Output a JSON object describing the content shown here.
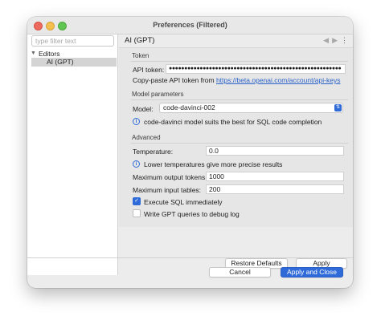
{
  "window": {
    "title": "Preferences (Filtered)"
  },
  "sidebar": {
    "filter_placeholder": "type filter text",
    "tree": {
      "editors_label": "Editors",
      "child_label": "AI (GPT)"
    }
  },
  "page": {
    "title": "AI (GPT)",
    "menu_icon": "⋮",
    "back_icon": "◀",
    "forward_icon": "▶"
  },
  "token": {
    "group_label": "Token",
    "api_label": "API token:",
    "api_value": "●●●●●●●●●●●●●●●●●●●●●●●●●●●●●●●●●●●●●●●●●●●●●●●●●●●●●●●●",
    "help_text": "Copy-paste API token from",
    "help_link": "https://beta.openai.com/account/api-keys"
  },
  "model": {
    "group_label": "Model parameters",
    "model_label": "Model:",
    "model_value": "code-davinci-002",
    "info_text": "code-davinci model suits the best for SQL code completion"
  },
  "advanced": {
    "group_label": "Advanced",
    "temperature_label": "Temperature:",
    "temperature_value": "0.0",
    "temperature_info": "Lower temperatures give more precise results",
    "max_output_label": "Maximum output tokens:",
    "max_output_value": "1000",
    "max_input_label": "Maximum input tables:",
    "max_input_value": "200",
    "execute_label": "Execute SQL immediately",
    "execute_checked": true,
    "log_label": "Write GPT queries to debug log",
    "log_checked": false
  },
  "buttons": {
    "restore": "Restore Defaults",
    "apply": "Apply",
    "cancel": "Cancel",
    "apply_close": "Apply and Close"
  },
  "colors": {
    "accent": "#2f6ad9",
    "link": "#2a61c8"
  }
}
